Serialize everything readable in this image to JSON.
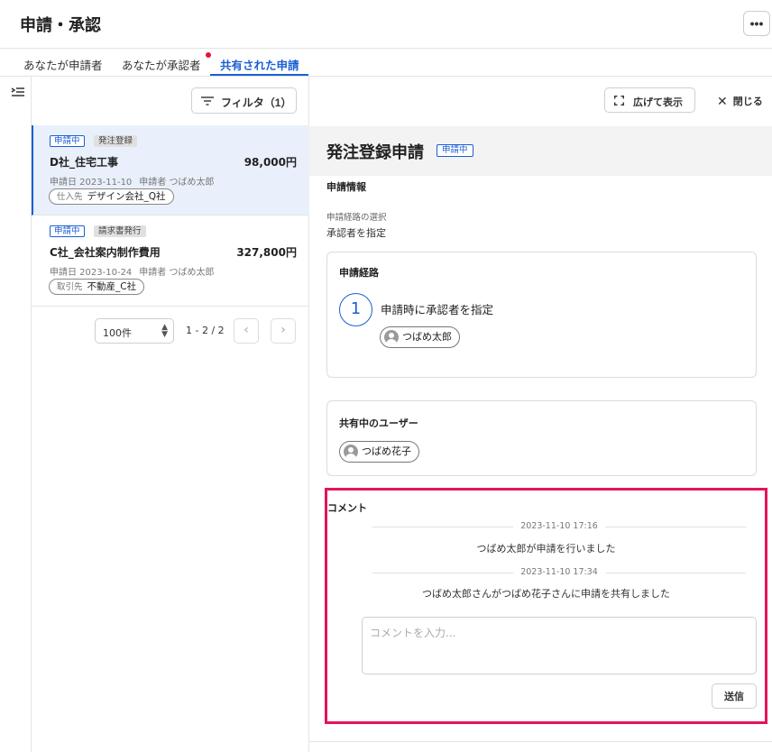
{
  "header": {
    "title": "申請・承認",
    "more_label": "•••"
  },
  "tabs": [
    {
      "label": "あなたが申請者"
    },
    {
      "label": "あなたが承認者"
    },
    {
      "label": "共有された申請"
    }
  ],
  "list": {
    "filter_label": "フィルタ（1）",
    "items": [
      {
        "status": "申請中",
        "type": "発注登録",
        "title": "D社_住宅工事",
        "amount": "98,000円",
        "date_text": "申請日 2023-11-10",
        "applicant_text": "申請者 つばめ太郎",
        "vendor_label": "仕入先",
        "vendor": "デザイン会社_Q社"
      },
      {
        "status": "申請中",
        "type": "請求書発行",
        "title": "C社_会社案内制作費用",
        "amount": "327,800円",
        "date_text": "申請日 2023-10-24",
        "applicant_text": "申請者 つばめ太郎",
        "vendor_label": "取引先",
        "vendor": "不動産_C社"
      }
    ],
    "pagination": {
      "per_page": "100件",
      "range": "1 - 2 / 2",
      "prev": "‹",
      "next": "›"
    }
  },
  "detail": {
    "expand_label": "広げて表示",
    "close_label": "閉じる",
    "title": "発注登録申請",
    "status": "申請中",
    "info_heading": "申請情報",
    "route_select_label": "申請経路の選択",
    "route_select_value": "承認者を指定",
    "route_card": {
      "heading": "申請経路",
      "step_number": "1",
      "step_text": "申請時に承認者を指定",
      "approver": "つばめ太郎"
    },
    "shared_card": {
      "heading": "共有中のユーザー",
      "user": "つばめ花子"
    },
    "comments": {
      "heading": "コメント",
      "events": [
        {
          "timestamp": "2023-11-10 17:16",
          "message": "つばめ太郎が申請を行いました"
        },
        {
          "timestamp": "2023-11-10 17:34",
          "message": "つばめ太郎さんがつばめ花子さんに申請を共有しました"
        }
      ],
      "input_placeholder": "コメントを入力...",
      "send_label": "送信"
    }
  },
  "colors": {
    "accent": "#1a5fd6",
    "highlight": "#e4135d",
    "notification": "#e2143a"
  }
}
